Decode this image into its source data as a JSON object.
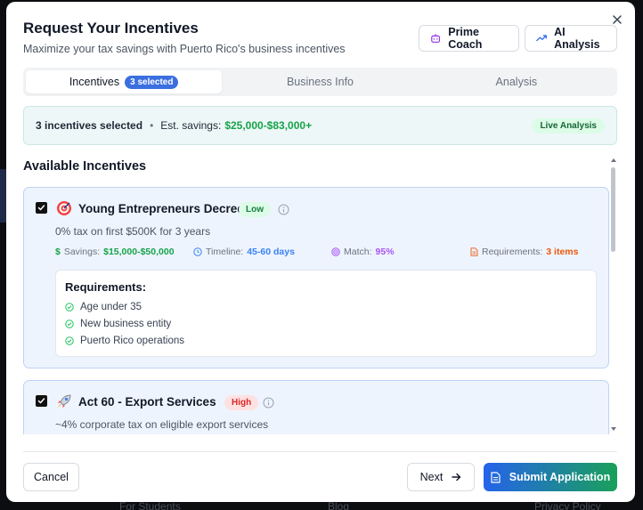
{
  "background": {
    "fragments": [
      "For Students",
      "Blog",
      "Privacy Policy"
    ]
  },
  "modal": {
    "title": "Request Your Incentives",
    "subtitle": "Maximize your tax savings with Puerto Rico's business incentives",
    "prime_coach_label": "Prime Coach",
    "ai_analysis_label": "AI Analysis",
    "close_icon": "close-icon"
  },
  "tabs": [
    {
      "label": "Incentives",
      "badge": "3 selected",
      "active": true
    },
    {
      "label": "Business Info",
      "active": false
    },
    {
      "label": "Analysis",
      "active": false
    }
  ],
  "summary": {
    "selected_text": "3 incentives selected",
    "separator": "•",
    "savings_label": "Est. savings:",
    "savings_value": "$25,000-$83,000+",
    "live_label": "Live Analysis"
  },
  "section_title": "Available Incentives",
  "incentives": [
    {
      "icon": "target-icon",
      "title": "Young Entrepreneurs Decree",
      "level": "Low",
      "description": "0% tax on first $500K for 3 years",
      "checked": true,
      "savings_label": "Savings:",
      "savings_value": "$15,000-$50,000",
      "timeline_label": "Timeline:",
      "timeline_value": "45-60 days",
      "match_label": "Match:",
      "match_value": "95%",
      "requirements_label": "Requirements:",
      "requirements_value": "3 items",
      "requirements_title": "Requirements:",
      "requirements": [
        "Age under 35",
        "New business entity",
        "Puerto Rico operations"
      ]
    },
    {
      "icon": "rocket-icon",
      "title": "Act 60 - Export Services",
      "level": "High",
      "description": "~4% corporate tax on eligible export services",
      "checked": true
    }
  ],
  "footer": {
    "cancel_label": "Cancel",
    "next_label": "Next",
    "submit_label": "Submit Application"
  },
  "colors": {
    "savings_green": "#16a34a",
    "timeline_blue": "#3b82f6",
    "match_purple": "#a855f7",
    "requirements_orange": "#ea580c",
    "submit_gradient_start": "#2563eb",
    "submit_gradient_end": "#1aa05a"
  }
}
